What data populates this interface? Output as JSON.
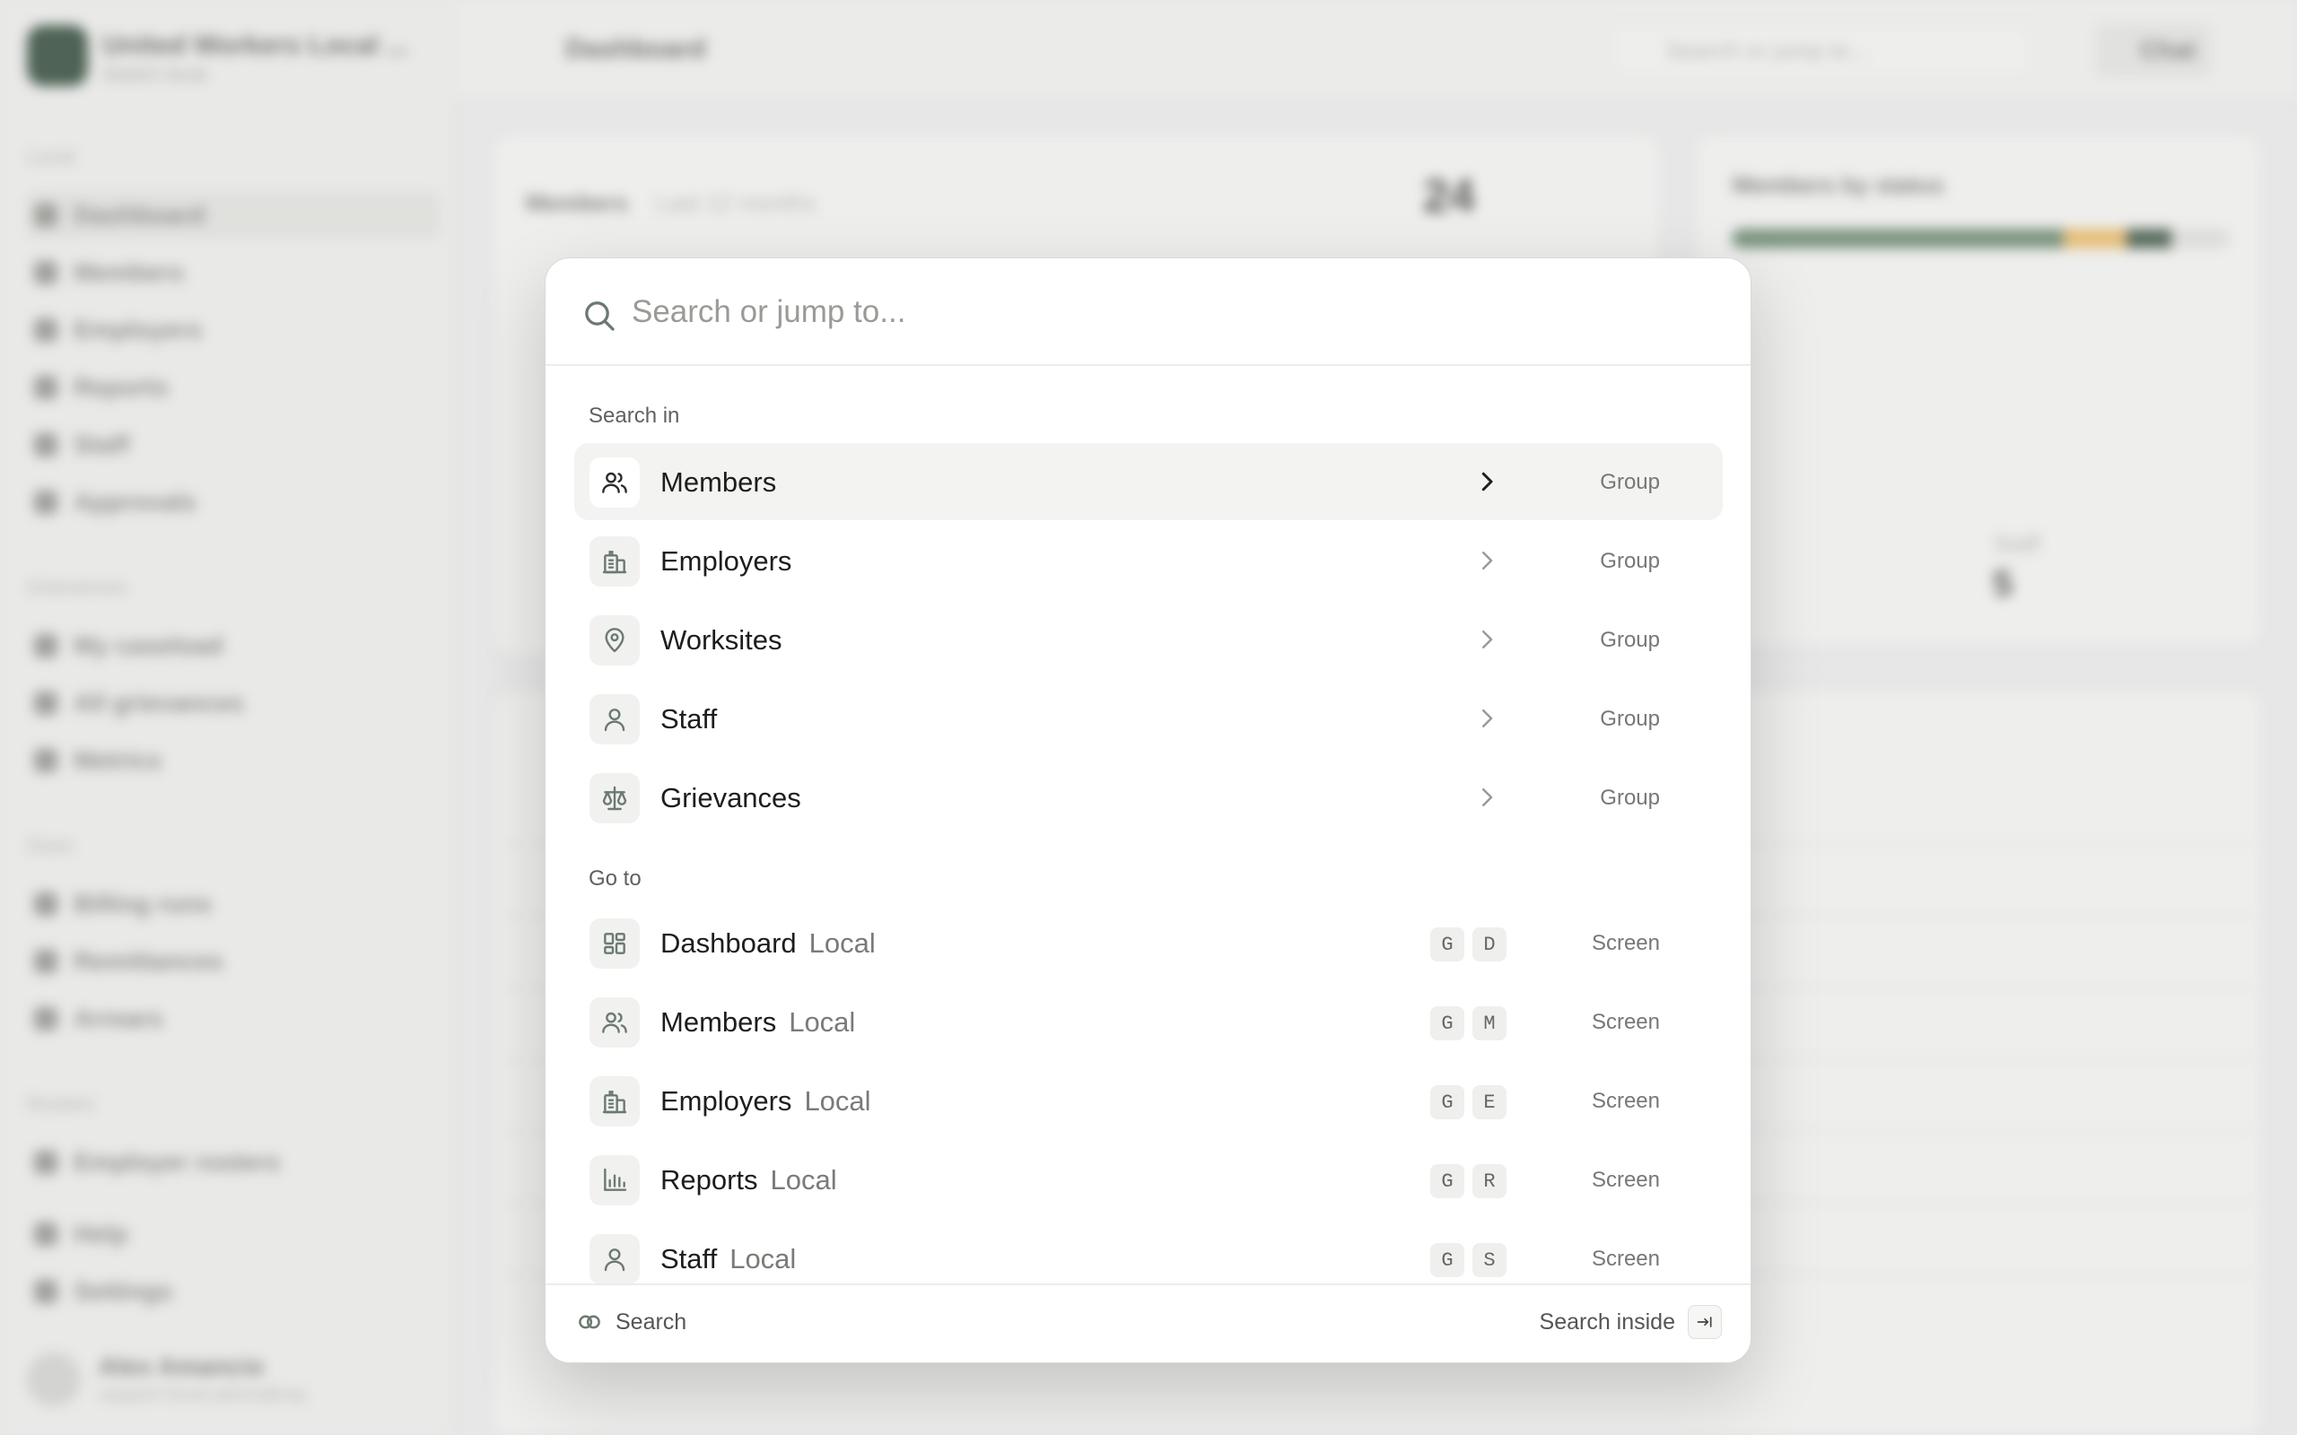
{
  "background": {
    "org_name": "United Workers Local ...",
    "org_sub": "Switch local",
    "page_title": "Dashboard",
    "search_placeholder": "Search or jump to...",
    "chat_label": "Chat",
    "nav_sections": [
      "Local",
      "Grievances",
      "Dues",
      "Rosters"
    ],
    "nav_items": [
      "Dashboard",
      "Members",
      "Employers",
      "Reports",
      "Staff",
      "Approvals",
      "My caseload",
      "All grievances",
      "Metrics",
      "Billing runs",
      "Remittances",
      "Arrears",
      "Employer rosters",
      "Help",
      "Settings"
    ],
    "user_name": "Alex Amancio",
    "user_email": "support+local-admin@org",
    "members_card_title": "Members",
    "members_card_range": "Last 12 months",
    "members_count": "24",
    "status_card_title": "Members by status",
    "staff_label": "Staff",
    "staff_count": "5"
  },
  "palette": {
    "search_placeholder": "Search or jump to...",
    "section_search_in": "Search in",
    "section_go_to": "Go to",
    "search_in": [
      {
        "label": "Members",
        "kind": "Group",
        "icon": "users-icon"
      },
      {
        "label": "Employers",
        "kind": "Group",
        "icon": "building-icon"
      },
      {
        "label": "Worksites",
        "kind": "Group",
        "icon": "map-pin-icon"
      },
      {
        "label": "Staff",
        "kind": "Group",
        "icon": "user-icon"
      },
      {
        "label": "Grievances",
        "kind": "Group",
        "icon": "scale-icon"
      }
    ],
    "go_to": [
      {
        "label": "Dashboard",
        "context": "Local",
        "keys": [
          "G",
          "D"
        ],
        "kind": "Screen",
        "icon": "dashboard-icon"
      },
      {
        "label": "Members",
        "context": "Local",
        "keys": [
          "G",
          "M"
        ],
        "kind": "Screen",
        "icon": "users-icon"
      },
      {
        "label": "Employers",
        "context": "Local",
        "keys": [
          "G",
          "E"
        ],
        "kind": "Screen",
        "icon": "building-icon"
      },
      {
        "label": "Reports",
        "context": "Local",
        "keys": [
          "G",
          "R"
        ],
        "kind": "Screen",
        "icon": "bar-chart-icon"
      },
      {
        "label": "Staff",
        "context": "Local",
        "keys": [
          "G",
          "S"
        ],
        "kind": "Screen",
        "icon": "user-icon"
      }
    ],
    "footer": {
      "left_label": "Search",
      "right_label": "Search inside"
    }
  }
}
